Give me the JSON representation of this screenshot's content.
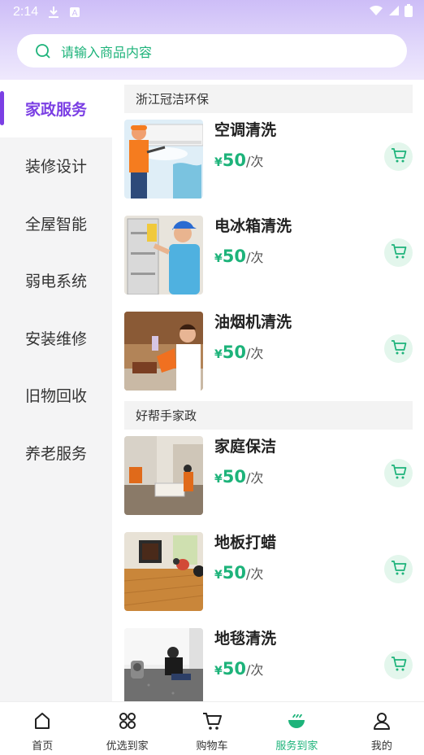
{
  "status_bar": {
    "time": "2:14"
  },
  "search": {
    "placeholder": "请输入商品内容"
  },
  "sidebar": {
    "items": [
      {
        "label": "家政服务",
        "active": true
      },
      {
        "label": "装修设计"
      },
      {
        "label": "全屋智能"
      },
      {
        "label": "弱电系统"
      },
      {
        "label": "安装维修"
      },
      {
        "label": "旧物回收"
      },
      {
        "label": "养老服务"
      }
    ]
  },
  "shops": [
    {
      "name": "浙江冠洁环保",
      "products": [
        {
          "name": "空调清洗",
          "currency": "¥",
          "price": "50",
          "unit": "/次",
          "icon": "aircon-cleaning"
        },
        {
          "name": "电冰箱清洗",
          "currency": "¥",
          "price": "50",
          "unit": "/次",
          "icon": "fridge-cleaning"
        },
        {
          "name": "油烟机清洗",
          "currency": "¥",
          "price": "50",
          "unit": "/次",
          "icon": "hood-cleaning"
        }
      ]
    },
    {
      "name": "好帮手家政",
      "products": [
        {
          "name": "家庭保洁",
          "currency": "¥",
          "price": "50",
          "unit": "/次",
          "icon": "home-cleaning"
        },
        {
          "name": "地板打蜡",
          "currency": "¥",
          "price": "50",
          "unit": "/次",
          "icon": "floor-waxing"
        },
        {
          "name": "地毯清洗",
          "currency": "¥",
          "price": "50",
          "unit": "/次",
          "icon": "carpet-cleaning"
        }
      ]
    }
  ],
  "bottom_nav": {
    "items": [
      {
        "label": "首页",
        "icon": "home-icon"
      },
      {
        "label": "优选到家",
        "icon": "grid-icon"
      },
      {
        "label": "购物车",
        "icon": "cart-icon"
      },
      {
        "label": "服务到家",
        "icon": "bowl-icon",
        "active": true
      },
      {
        "label": "我的",
        "icon": "user-icon"
      }
    ]
  },
  "colors": {
    "accent": "#7b3fe4",
    "green": "#1db37a"
  }
}
